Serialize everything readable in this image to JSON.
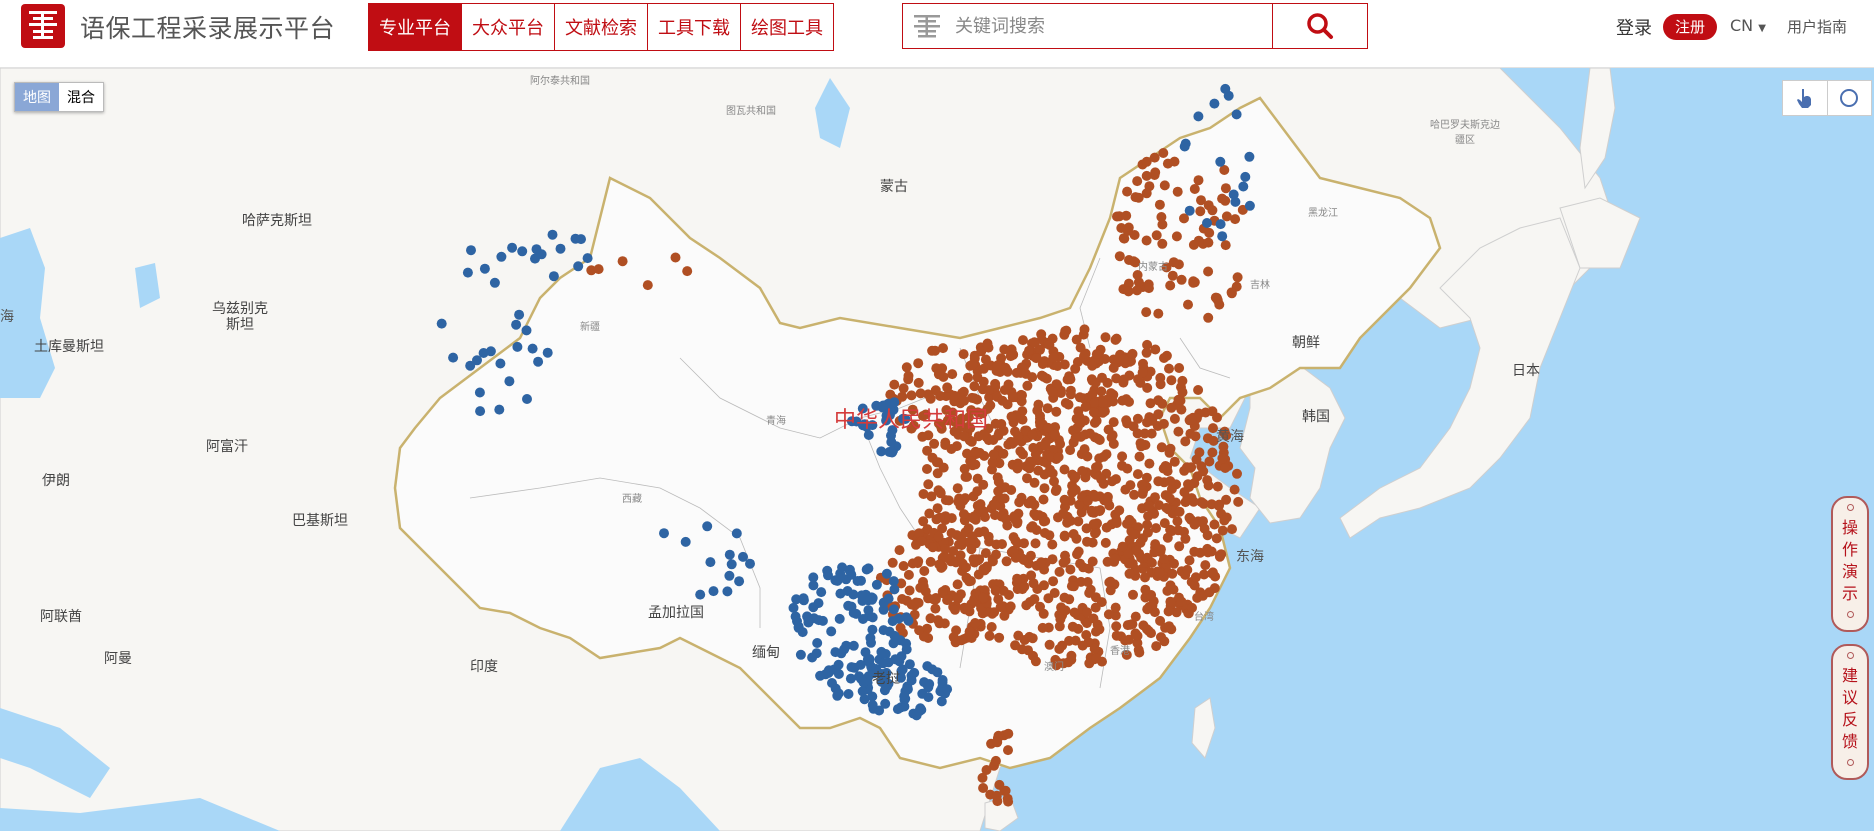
{
  "site": {
    "title": "语保工程采录展示平台"
  },
  "nav": [
    {
      "label": "专业平台",
      "active": true
    },
    {
      "label": "大众平台",
      "active": false
    },
    {
      "label": "文献检索",
      "active": false
    },
    {
      "label": "工具下载",
      "active": false
    },
    {
      "label": "绘图工具",
      "active": false
    }
  ],
  "search": {
    "placeholder": "关键词搜索"
  },
  "account": {
    "login": "登录",
    "register": "注册",
    "lang": "CN",
    "guide": "用户指南"
  },
  "map_type": {
    "map": "地图",
    "hybrid": "混合"
  },
  "side_tabs": {
    "demo": [
      "操",
      "作",
      "演",
      "示"
    ],
    "feedback": [
      "建",
      "议",
      "反",
      "馈"
    ]
  },
  "labels": {
    "kazakhstan": "哈萨克斯坦",
    "mongolia": "蒙古",
    "uzbekistan": "乌兹别克",
    "uzbekistan2": "斯坦",
    "turkmenistan": "土库曼斯坦",
    "afghanistan": "阿富汗",
    "iran": "伊朗",
    "pakistan": "巴基斯坦",
    "uae": "阿联酋",
    "oman": "阿曼",
    "india": "印度",
    "bangladesh": "孟加拉国",
    "myanmar": "缅甸",
    "laos": "老挝",
    "north_korea": "朝鲜",
    "south_korea": "韩国",
    "japan": "日本",
    "yellow_sea": "黄海",
    "east_sea": "东海",
    "sea_w": "海",
    "china": "中华人民共和国",
    "xinjiang": "新疆",
    "qinghai": "青海",
    "xizang": "西藏",
    "neimenggu": "内蒙古",
    "heilongjiang": "黑龙江",
    "jilin": "吉林",
    "altay": "阿尔泰共和国",
    "tuva": "图瓦共和国",
    "khabarovsk": "哈巴罗夫斯克边疆区",
    "taiwan": "台湾",
    "macau": "澳门",
    "hongkong": "香港"
  },
  "colors": {
    "brand": "#c00d13",
    "dot_blue": "#2e64a3",
    "dot_orange": "#b04f23",
    "sea": "#a9d7f7",
    "land": "#f7f6f3",
    "china_border": "#c9b26e"
  }
}
